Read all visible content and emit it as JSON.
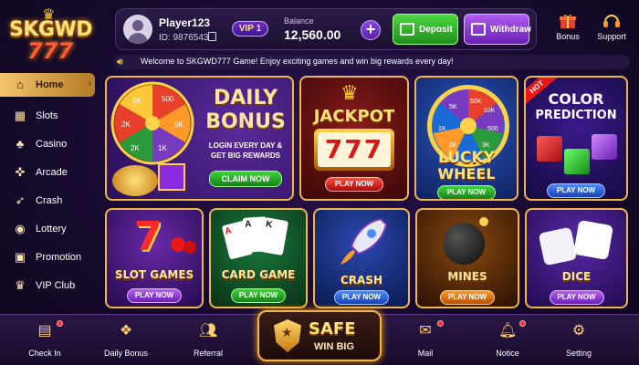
{
  "brand": {
    "logo_top": "SKGWD",
    "logo_bottom": "777"
  },
  "user": {
    "name": "Player123",
    "id": "ID: 9876543",
    "vip": "VIP 1",
    "balance_label": "Balance",
    "balance": "12,560.00"
  },
  "actions": {
    "plus": "+",
    "deposit": "Deposit",
    "withdraw": "Withdraw"
  },
  "top_icons": {
    "bonus": "Bonus",
    "support": "Support"
  },
  "marquee": {
    "text": "Welcome to SKGWD777 Game! Enjoy exciting games and win big rewards every day!"
  },
  "sidebar": {
    "items": [
      {
        "label": "Home",
        "icon": "home-icon",
        "active": true
      },
      {
        "label": "Slots",
        "icon": "slots-icon"
      },
      {
        "label": "Casino",
        "icon": "casino-icon"
      },
      {
        "label": "Arcade",
        "icon": "arcade-icon"
      },
      {
        "label": "Crash",
        "icon": "crash-icon"
      },
      {
        "label": "Lottery",
        "icon": "lottery-icon"
      },
      {
        "label": "Promotion",
        "icon": "promotion-icon"
      },
      {
        "label": "VIP Club",
        "icon": "vip-club-icon"
      }
    ]
  },
  "cards": {
    "daily_bonus": {
      "title1": "DAILY",
      "title2": "BONUS",
      "desc1": "LOGIN EVERY DAY &",
      "desc2": "GET BIG REWARDS",
      "button": "CLAIM NOW",
      "wheel_labels": [
        "500",
        "5K",
        "1K",
        "2K",
        "2K",
        "5K"
      ]
    },
    "jackpot": {
      "title": "JACKPOT",
      "reels": "777",
      "button": "PLAY NOW"
    },
    "lucky_wheel": {
      "title1": "LUCKY",
      "title2": "WHEEL",
      "button": "PLAY NOW",
      "wheel_labels": [
        "50K",
        "5K",
        "10K",
        "500",
        "3K",
        "2K",
        "1K"
      ]
    },
    "color_prediction": {
      "badge": "HOT",
      "title1": "COLOR",
      "title2": "PREDICTION",
      "button": "PLAY NOW"
    },
    "slot_games": {
      "title": "SLOT GAMES",
      "button": "PLAY NOW"
    },
    "card_game": {
      "title": "CARD GAME",
      "button": "PLAY NOW"
    },
    "crash": {
      "title": "CRASH",
      "button": "PLAY NOW"
    },
    "mines": {
      "title": "MINES",
      "button": "PLAY NOW"
    },
    "dice": {
      "title": "DICE",
      "button": "PLAY NOW"
    }
  },
  "bottom_nav": {
    "check_in": "Check In",
    "daily_bonus": "Daily Bonus",
    "referral": "Referral",
    "safe_line1": "SAFE",
    "safe_line2": "WIN BIG",
    "mail": "Mail",
    "notice": "Notice",
    "setting": "Setting"
  }
}
